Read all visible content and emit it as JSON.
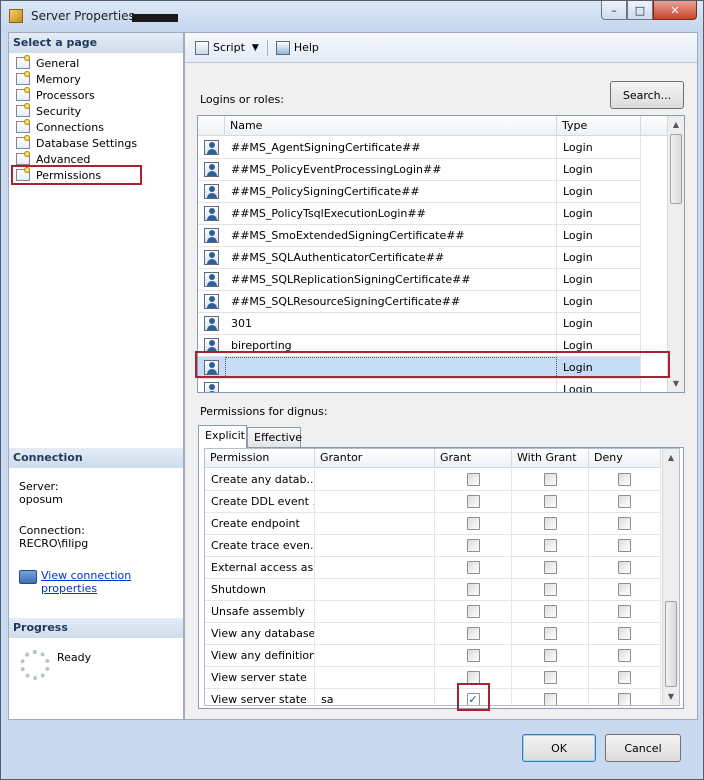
{
  "window": {
    "title": "Server Properties -",
    "controls": {
      "minimize": "–",
      "maximize": "□",
      "close": "✕"
    }
  },
  "sidebar": {
    "select_page_header": "Select a page",
    "pages": [
      {
        "label": "General",
        "icon": "wrench-page-icon"
      },
      {
        "label": "Memory",
        "icon": "wrench-page-icon"
      },
      {
        "label": "Processors",
        "icon": "wrench-page-icon"
      },
      {
        "label": "Security",
        "icon": "wrench-page-icon"
      },
      {
        "label": "Connections",
        "icon": "wrench-page-icon"
      },
      {
        "label": "Database Settings",
        "icon": "wrench-page-icon"
      },
      {
        "label": "Advanced",
        "icon": "wrench-page-icon"
      },
      {
        "label": "Permissions",
        "icon": "wrench-page-icon",
        "selected": true
      }
    ],
    "connection_header": "Connection",
    "server_label": "Server:",
    "server_value": "oposum",
    "connection_label": "Connection:",
    "connection_value": "RECRO\\filipg",
    "view_link_line1": "View connection",
    "view_link_line2": "properties",
    "progress_header": "Progress",
    "progress_status": "Ready"
  },
  "toolbar": {
    "script_label": "Script",
    "script_caret": "▼",
    "help_label": "Help"
  },
  "logins": {
    "label": "Logins or roles:",
    "search_button": "Search...",
    "columns": {
      "name": "Name",
      "type": "Type"
    },
    "rows": [
      {
        "name": "##MS_AgentSigningCertificate##",
        "type": "Login"
      },
      {
        "name": "##MS_PolicyEventProcessingLogin##",
        "type": "Login"
      },
      {
        "name": "##MS_PolicySigningCertificate##",
        "type": "Login"
      },
      {
        "name": "##MS_PolicyTsqlExecutionLogin##",
        "type": "Login"
      },
      {
        "name": "##MS_SmoExtendedSigningCertificate##",
        "type": "Login"
      },
      {
        "name": "##MS_SQLAuthenticatorCertificate##",
        "type": "Login"
      },
      {
        "name": "##MS_SQLReplicationSigningCertificate##",
        "type": "Login"
      },
      {
        "name": "##MS_SQLResourceSigningCertificate##",
        "type": "Login"
      },
      {
        "name": "301",
        "type": "Login"
      },
      {
        "name": "bireporting",
        "type": "Login"
      },
      {
        "name": "",
        "type": "Login",
        "selected": true
      },
      {
        "name": "",
        "type": "Login"
      }
    ]
  },
  "permissions": {
    "label": "Permissions for dignus:",
    "tabs": [
      {
        "label": "Explicit",
        "active": true
      },
      {
        "label": "Effective",
        "active": false
      }
    ],
    "columns": {
      "permission": "Permission",
      "grantor": "Grantor",
      "grant": "Grant",
      "with_grant": "With Grant",
      "deny": "Deny"
    },
    "rows": [
      {
        "permission": "Create any datab...",
        "grantor": "",
        "grant": false,
        "with_grant": false,
        "deny": false
      },
      {
        "permission": "Create DDL event ...",
        "grantor": "",
        "grant": false,
        "with_grant": false,
        "deny": false
      },
      {
        "permission": "Create endpoint",
        "grantor": "",
        "grant": false,
        "with_grant": false,
        "deny": false
      },
      {
        "permission": "Create trace even...",
        "grantor": "",
        "grant": false,
        "with_grant": false,
        "deny": false
      },
      {
        "permission": "External access as...",
        "grantor": "",
        "grant": false,
        "with_grant": false,
        "deny": false
      },
      {
        "permission": "Shutdown",
        "grantor": "",
        "grant": false,
        "with_grant": false,
        "deny": false
      },
      {
        "permission": "Unsafe assembly",
        "grantor": "",
        "grant": false,
        "with_grant": false,
        "deny": false
      },
      {
        "permission": "View any database",
        "grantor": "",
        "grant": false,
        "with_grant": false,
        "deny": false
      },
      {
        "permission": "View any definition",
        "grantor": "",
        "grant": false,
        "with_grant": false,
        "deny": false
      },
      {
        "permission": "View server state",
        "grantor": "",
        "grant": false,
        "with_grant": false,
        "deny": false
      },
      {
        "permission": "View server state",
        "grantor": "sa",
        "grant": true,
        "with_grant": false,
        "deny": false
      }
    ]
  },
  "footer": {
    "ok_label": "OK",
    "cancel_label": "Cancel"
  },
  "colors": {
    "highlight_box": "#a8232d",
    "selected_row": "#c6dcf5",
    "link": "#0033cc"
  }
}
